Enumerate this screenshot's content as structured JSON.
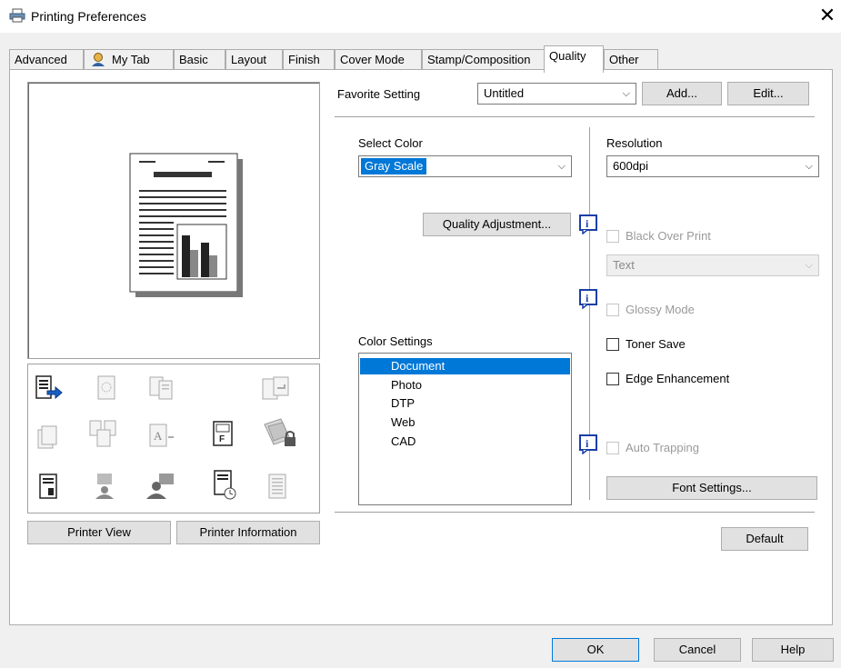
{
  "window": {
    "title": "Printing Preferences",
    "close_glyph": "✕"
  },
  "tabs": [
    {
      "label": "Advanced"
    },
    {
      "label": "My Tab"
    },
    {
      "label": "Basic"
    },
    {
      "label": "Layout"
    },
    {
      "label": "Finish"
    },
    {
      "label": "Cover Mode"
    },
    {
      "label": "Stamp/Composition"
    },
    {
      "label": "Quality",
      "active": true
    },
    {
      "label": "Other"
    }
  ],
  "left": {
    "printer_view_label": "Printer View",
    "printer_information_label": "Printer Information"
  },
  "favorite": {
    "label": "Favorite Setting",
    "value": "Untitled",
    "add_label": "Add...",
    "edit_label": "Edit..."
  },
  "select_color": {
    "label": "Select Color",
    "value": "Gray Scale"
  },
  "resolution": {
    "label": "Resolution",
    "value": "600dpi"
  },
  "quality_adjustment_label": "Quality Adjustment...",
  "black_over_print": {
    "label": "Black Over Print",
    "enabled": false,
    "combo_value": "Text"
  },
  "glossy_mode": {
    "label": "Glossy Mode",
    "enabled": false
  },
  "toner_save": {
    "label": "Toner Save",
    "checked": false
  },
  "edge_enhancement": {
    "label": "Edge Enhancement",
    "checked": false
  },
  "auto_trapping": {
    "label": "Auto Trapping",
    "enabled": false
  },
  "color_settings": {
    "label": "Color Settings",
    "items": [
      "Document",
      "Photo",
      "DTP",
      "Web",
      "CAD"
    ],
    "selected": "Document"
  },
  "font_settings_label": "Font Settings...",
  "default_label": "Default",
  "footer": {
    "ok_label": "OK",
    "cancel_label": "Cancel",
    "help_label": "Help"
  },
  "colors": {
    "accent": "#0078d7",
    "dialog_bg": "#f0f0f0",
    "button_bg": "#e1e1e1",
    "info_icon": "#1a3ea8"
  }
}
